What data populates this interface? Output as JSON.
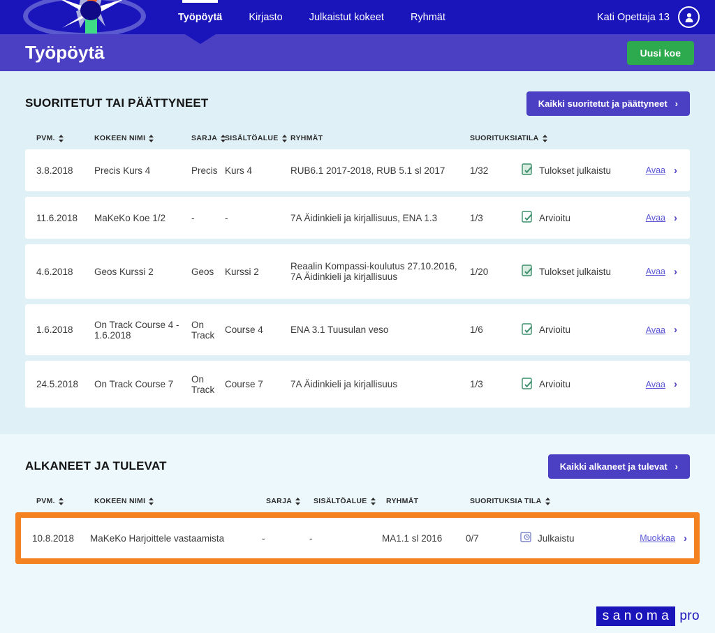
{
  "topnav": {
    "logo_name": "abitti-flower-logo",
    "items": [
      {
        "label": "Työpöytä",
        "active": true
      },
      {
        "label": "Kirjasto",
        "active": false
      },
      {
        "label": "Julkaistut kokeet",
        "active": false
      },
      {
        "label": "Ryhmät",
        "active": false
      }
    ],
    "user_name": "Kati Opettaja 13"
  },
  "subheader": {
    "title": "Työpöytä",
    "new_exam_label": "Uusi koe"
  },
  "colors": {
    "nav_blue": "#1a14bb",
    "sub_purple": "#4b3fc4",
    "green": "#2eaa4e",
    "highlight_orange": "#f58220",
    "page_bg_top": "#dff0f7",
    "page_bg_bottom": "#edf8fc",
    "link_purple": "#5b57d6"
  },
  "completed_section": {
    "title": "SUORITETUT TAI PÄÄTTYNEET",
    "all_button_label": "Kaikki suoritetut ja päättyneet",
    "columns": [
      {
        "label": "PVM.",
        "sortable": true
      },
      {
        "label": "KOKEEN NIMI",
        "sortable": true
      },
      {
        "label": "SARJA",
        "sortable": true
      },
      {
        "label": "SISÄLTÖALUE",
        "sortable": true
      },
      {
        "label": "RYHMÄT",
        "sortable": false
      },
      {
        "label": "SUORITUKSIA",
        "sortable": false
      },
      {
        "label": "TILA",
        "sortable": true
      }
    ],
    "rows": [
      {
        "date": "3.8.2018",
        "name": "Precis Kurs 4",
        "serie": "Precis",
        "area": "Kurs 4",
        "groups": "RUB6.1 2017-2018, RUB 5.1 sl 2017",
        "submissions": "1/32",
        "status": "Tulokset julkaistu",
        "status_icon": "document-check-filled-icon",
        "action": "Avaa"
      },
      {
        "date": "11.6.2018",
        "name": "MaKeKo Koe 1/2",
        "serie": "-",
        "area": "-",
        "groups": "7A Äidinkieli ja kirjallisuus, ENA 1.3",
        "submissions": "1/3",
        "status": "Arvioitu",
        "status_icon": "document-check-outline-icon",
        "action": "Avaa"
      },
      {
        "date": "4.6.2018",
        "name": "Geos Kurssi 2",
        "serie": "Geos",
        "area": "Kurssi 2",
        "groups": "Reaalin Kompassi-koulutus 27.10.2016, 7A Äidinkieli ja kirjallisuus",
        "submissions": "1/20",
        "status": "Tulokset julkaistu",
        "status_icon": "document-check-filled-icon",
        "action": "Avaa"
      },
      {
        "date": "1.6.2018",
        "name": "On Track Course 4 - 1.6.2018",
        "serie": "On Track",
        "area": "Course 4",
        "groups": "ENA 3.1 Tuusulan veso",
        "submissions": "1/6",
        "status": "Arvioitu",
        "status_icon": "document-check-outline-icon",
        "action": "Avaa"
      },
      {
        "date": "24.5.2018",
        "name": "On Track Course 7",
        "serie": "On Track",
        "area": "Course 7",
        "groups": "7A Äidinkieli ja kirjallisuus",
        "submissions": "1/3",
        "status": "Arvioitu",
        "status_icon": "document-check-outline-icon",
        "action": "Avaa"
      }
    ]
  },
  "upcoming_section": {
    "title": "ALKANEET JA TULEVAT",
    "all_button_label": "Kaikki alkaneet ja tulevat",
    "columns": [
      {
        "label": "PVM.",
        "sortable": true
      },
      {
        "label": "KOKEEN NIMI",
        "sortable": true
      },
      {
        "label": "SARJA",
        "sortable": true
      },
      {
        "label": "SISÄLTÖALUE",
        "sortable": true
      },
      {
        "label": "RYHMÄT",
        "sortable": false
      },
      {
        "label": "SUORITUKSIA",
        "sortable": false
      },
      {
        "label": "TILA",
        "sortable": true
      }
    ],
    "rows": [
      {
        "date": "10.8.2018",
        "name": "MaKeKo Harjoittele vastaamista",
        "serie": "-",
        "area": "-",
        "groups": "MA1.1 sl 2016",
        "submissions": "0/7",
        "status": "Julkaistu",
        "status_icon": "document-clock-icon",
        "action": "Muokkaa",
        "highlighted": true
      }
    ]
  },
  "footer": {
    "brand_mark": "sanoma",
    "brand_suffix": "pro"
  }
}
